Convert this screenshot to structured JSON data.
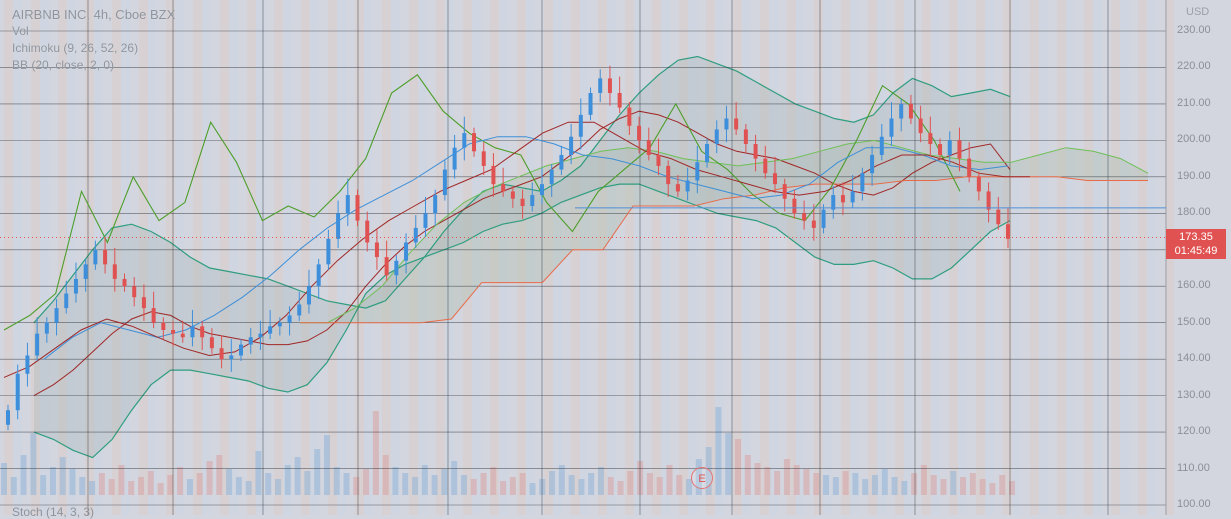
{
  "legend": {
    "symbol": "AIRBNB INC, 4h, Cboe BZX",
    "indicator_1": "Vol",
    "indicator_2": "Ichimoku (9, 26, 52, 26)",
    "indicator_3": "BB (20, close, 2, 0)"
  },
  "stoch_label": "Stoch (14, 3, 3)",
  "currency": "USD",
  "last_price": {
    "value": "173.35",
    "countdown": "01:45:49"
  },
  "earnings_marker": "E",
  "colors": {
    "up": "#3d8fdb",
    "down": "#e05252",
    "bb": "#2f9d7f",
    "lagging": "#4d9e2a",
    "kijun": "#a02626",
    "tenkan": "#3e8fd8",
    "span_b": "#e86a4a",
    "cloud": "#b4c2b4"
  },
  "chart_data": {
    "type": "line",
    "ylim": [
      100,
      235
    ],
    "yticks": [
      100,
      110,
      120,
      130,
      140,
      150,
      160,
      170,
      180,
      190,
      200,
      210,
      220,
      230
    ],
    "ytick_labels": [
      "100.00",
      "110.00",
      "120.00",
      "130.00",
      "140.00",
      "150.00",
      "160.00",
      "170.00",
      "180.00",
      "190.00",
      "200.00",
      "210.00",
      "220.00",
      "230.00"
    ],
    "candles_close": [
      126,
      136,
      141,
      147,
      150,
      154,
      158,
      162,
      166,
      170,
      166,
      162,
      160,
      157,
      154,
      150,
      148,
      147,
      146,
      149,
      146,
      143,
      140,
      141,
      144,
      146,
      147,
      149,
      150,
      152,
      155,
      160,
      166,
      173,
      180,
      185,
      178,
      172,
      168,
      163,
      167,
      172,
      176,
      180,
      185,
      192,
      198,
      202,
      197,
      193,
      188,
      186,
      184,
      182,
      185,
      188,
      192,
      196,
      201,
      207,
      213,
      217,
      213,
      209,
      204,
      200,
      196,
      193,
      188,
      186,
      189,
      194,
      199,
      203,
      206,
      203,
      199,
      195,
      191,
      188,
      184,
      180,
      178,
      176,
      181,
      185,
      183,
      186,
      191,
      196,
      201,
      206,
      210,
      206,
      202,
      199,
      196,
      200,
      195,
      190,
      186,
      181,
      177,
      173
    ],
    "bb_upper": [
      150,
      156,
      163,
      170,
      176,
      177,
      175,
      172,
      168,
      165,
      164,
      163,
      162,
      160,
      158,
      156,
      155,
      154,
      156,
      162,
      168,
      175,
      181,
      186,
      188,
      187,
      186,
      189,
      193,
      200,
      207,
      213,
      218,
      222,
      223,
      221,
      219,
      216,
      213,
      210,
      208,
      206,
      205,
      207,
      213,
      217,
      215,
      212,
      213,
      214,
      212
    ],
    "bb_mid": [
      130,
      133,
      137,
      142,
      147,
      151,
      153,
      152,
      149,
      147,
      146,
      145,
      144,
      144,
      145,
      148,
      153,
      160,
      166,
      171,
      175,
      178,
      181,
      184,
      186,
      188,
      190,
      194,
      198,
      203,
      206,
      208,
      207,
      205,
      202,
      199,
      197,
      196,
      195,
      193,
      191,
      188,
      186,
      185,
      187,
      191,
      194,
      196,
      198,
      199,
      192
    ],
    "bb_lower": [
      120,
      118,
      115,
      113,
      118,
      126,
      133,
      137,
      137,
      136,
      135,
      134,
      132,
      131,
      133,
      139,
      148,
      158,
      163,
      166,
      168,
      170,
      172,
      175,
      177,
      178,
      180,
      183,
      185,
      187,
      188,
      188,
      186,
      184,
      182,
      180,
      179,
      178,
      176,
      172,
      168,
      166,
      166,
      167,
      165,
      162,
      162,
      165,
      170,
      175,
      178
    ],
    "kijun": [
      135,
      138,
      143,
      148,
      151,
      149,
      146,
      143,
      141,
      142,
      146,
      152,
      160,
      167,
      173,
      178,
      182,
      186,
      189,
      192,
      197,
      202,
      205,
      205,
      201,
      197,
      195,
      192,
      190,
      188,
      186,
      185,
      186,
      189,
      193,
      196,
      196,
      194,
      191,
      190,
      190
    ],
    "tenkan": [
      140,
      146,
      150,
      148,
      146,
      148,
      152,
      157,
      163,
      170,
      176,
      181,
      185,
      189,
      194,
      199,
      201,
      201,
      199,
      196,
      195,
      193,
      190,
      188,
      186,
      184,
      185,
      188,
      194,
      198,
      198,
      196,
      193,
      192,
      193
    ],
    "lagging": [
      148,
      152,
      158,
      186,
      172,
      190,
      178,
      183,
      205,
      194,
      178,
      182,
      179,
      186,
      195,
      213,
      218,
      208,
      202,
      198,
      196,
      183,
      175,
      186,
      192,
      198,
      210,
      197,
      192,
      185,
      180,
      178,
      187,
      200,
      215,
      210,
      200,
      186
    ],
    "span_a": [
      150,
      150,
      154,
      160,
      169,
      177,
      183,
      187,
      190,
      193,
      195,
      197,
      198,
      197,
      195,
      194,
      193,
      194,
      195,
      197,
      199,
      200,
      198,
      196,
      195,
      194,
      194,
      196,
      198,
      197,
      195,
      191
    ],
    "span_b": [
      150,
      150,
      150,
      150,
      150,
      151,
      161,
      161,
      161,
      170,
      170,
      182,
      182,
      182,
      184,
      185,
      187,
      188,
      188,
      188,
      189,
      189,
      190,
      190,
      190,
      190,
      189,
      189,
      189
    ],
    "volume": [
      32,
      18,
      40,
      62,
      20,
      28,
      38,
      26,
      18,
      14,
      22,
      16,
      30,
      14,
      18,
      24,
      12,
      20,
      28,
      16,
      22,
      34,
      40,
      26,
      18,
      14,
      44,
      22,
      16,
      30,
      38,
      24,
      46,
      60,
      28,
      22,
      18,
      26,
      84,
      40,
      28,
      22,
      18,
      30,
      20,
      26,
      34,
      20,
      16,
      22,
      28,
      14,
      18,
      22,
      12,
      16,
      24,
      30,
      20,
      16,
      22,
      28,
      18,
      14,
      24,
      34,
      22,
      18,
      30,
      20,
      16,
      36,
      48,
      88,
      62,
      56,
      40,
      32,
      28,
      24,
      36,
      30,
      26,
      22,
      20,
      18,
      24,
      22,
      16,
      20,
      26,
      18,
      14,
      22,
      30,
      20,
      16,
      24,
      18,
      22,
      16,
      12,
      20,
      14
    ]
  }
}
